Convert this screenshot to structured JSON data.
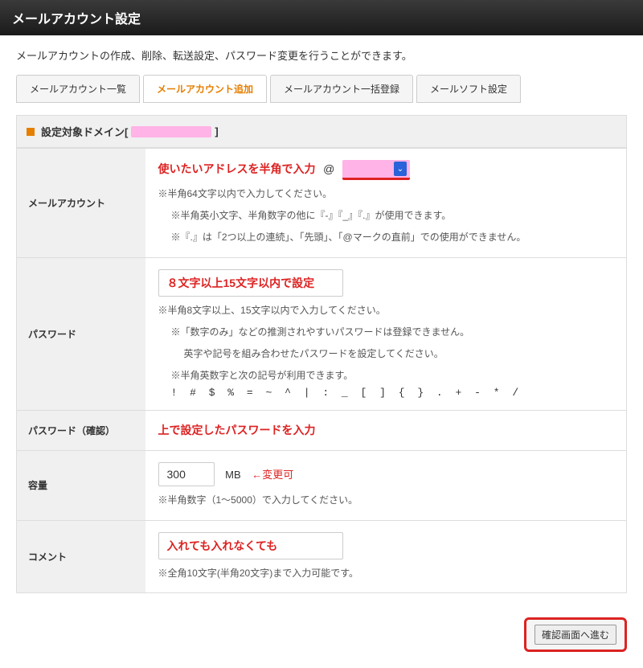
{
  "header": {
    "title": "メールアカウント設定"
  },
  "description": "メールアカウントの作成、削除、転送設定、パスワード変更を行うことができます。",
  "tabs": {
    "list": "メールアカウント一覧",
    "add": "メールアカウント追加",
    "bulk": "メールアカウント一括登録",
    "soft": "メールソフト設定"
  },
  "domain_header": {
    "prefix": "設定対象ドメイン[",
    "suffix": "]"
  },
  "fields": {
    "account": {
      "label": "メールアカウント",
      "annotation": "使いたいアドレスを半角で入力",
      "at": "@",
      "hint1": "※半角64文字以内で入力してください。",
      "hint2": "※半角英小文字、半角数字の他に『-』『_』『.』が使用できます。",
      "hint3": "※『.』は「2つ以上の連続」、「先頭」、「@マークの直前」での使用ができません。"
    },
    "password": {
      "label": "パスワード",
      "annotation": "８文字以上15文字以内で設定",
      "hint1": "※半角8文字以上、15文字以内で入力してください。",
      "hint2": "※「数字のみ」などの推測されやすいパスワードは登録できません。",
      "hint3": "英字や記号を組み合わせたパスワードを設定してください。",
      "hint4": "※半角英数字と次の記号が利用できます。",
      "symbols": "! # $ % = ~ ^ | : _ [ ] { } . + - * /"
    },
    "password_confirm": {
      "label": "パスワード（確認）",
      "annotation": "上で設定したパスワードを入力"
    },
    "capacity": {
      "label": "容量",
      "value": "300",
      "unit": "MB",
      "change_note": "←変更可",
      "hint": "※半角数字（1～5000）で入力してください。"
    },
    "comment": {
      "label": "コメント",
      "annotation": "入れても入れなくても",
      "hint": "※全角10文字(半角20文字)まで入力可能です。"
    }
  },
  "footer": {
    "submit": "確認画面へ進む"
  }
}
